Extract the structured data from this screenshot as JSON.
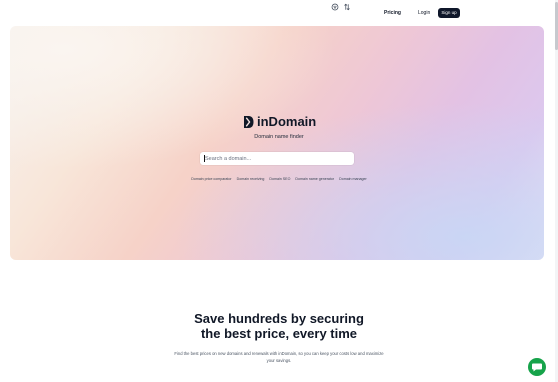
{
  "nav": {
    "pricing": "Pricing",
    "login": "Login",
    "signup": "Sign up"
  },
  "hero": {
    "brand": "inDomain",
    "subtitle": "Domain name finder",
    "search_placeholder": "Search a domain...",
    "links": [
      "Domain price comparator",
      "Domain receiving",
      "Domain SEO",
      "Domain name generator",
      "Domain manager"
    ]
  },
  "section": {
    "headline_line1": "Save hundreds by securing",
    "headline_line2": "the best price, every time",
    "description": "Find the best prices on new domains and renewals with inDomain, so you can keep your costs low and maximize your savings."
  },
  "icons": {
    "filter": "filter-icon",
    "sort": "sort-icon",
    "chat": "chat-icon",
    "logo": "indomain-logo-icon"
  },
  "colors": {
    "signup_bg": "#0f172a",
    "chat_bg": "#16a34a"
  }
}
